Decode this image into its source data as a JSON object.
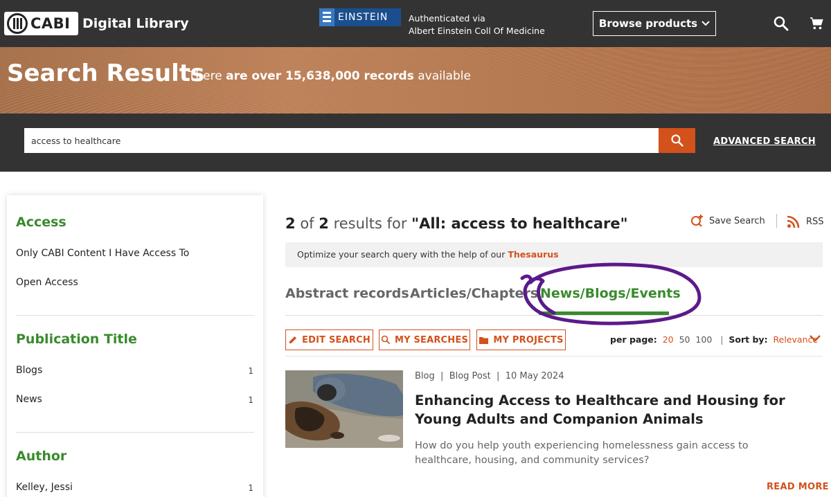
{
  "header": {
    "logo_brand": "CABI",
    "logo_text": "Digital Library",
    "institution_logo": "EINSTEIN",
    "auth_line1": "Authenticated via",
    "auth_line2": "Albert Einstein Coll Of Medicine",
    "browse_label": "Browse products",
    "icons": [
      "search-icon",
      "cart-icon"
    ]
  },
  "hero": {
    "title": "Search Results",
    "sub_prefix": "There",
    "sub_bold": "are over 15,638,000 records",
    "sub_suffix": "available"
  },
  "search": {
    "value": "access to healthcare",
    "advanced_label": "ADVANCED SEARCH"
  },
  "sidebar": {
    "access_heading": "Access",
    "access_items": [
      "Only CABI Content I Have Access To",
      "Open Access"
    ],
    "pub_heading": "Publication Title",
    "pub_items": [
      {
        "label": "Blogs",
        "count": "1"
      },
      {
        "label": "News",
        "count": "1"
      }
    ],
    "author_heading": "Author",
    "author_items": [
      {
        "label": "Kelley, Jessi",
        "count": "1"
      }
    ]
  },
  "results": {
    "shown": "2",
    "of": "of",
    "total": "2",
    "results_for": "results for",
    "query": "\"All: access to healthcare\"",
    "save_search": "Save Search",
    "rss": "RSS",
    "optimize_text": "Optimize your search query with the help of our",
    "thesaurus": "Thesaurus"
  },
  "tabs": [
    {
      "label": "Abstract records",
      "active": false
    },
    {
      "label": "Articles/Chapters",
      "active": false
    },
    {
      "label": "News/Blogs/Events",
      "active": true
    }
  ],
  "toolbar": {
    "edit_search": "EDIT SEARCH",
    "my_searches": "MY SEARCHES",
    "my_projects": "MY PROJECTS",
    "per_page_label": "per page:",
    "per_page_options": [
      "20",
      "50",
      "100"
    ],
    "per_page_selected": "20",
    "sort_label": "Sort by:",
    "sort_value": "Relevance"
  },
  "result_item": {
    "type": "Blog",
    "subtype": "Blog Post",
    "date": "10 May 2024",
    "title": "Enhancing Access to Healthcare and Housing for Young Adults and Companion Animals",
    "description": "How do you help youth experiencing homelessness gain access to healthcare, housing, and community services?",
    "read_more": "READ MORE"
  },
  "colors": {
    "accent_orange": "#d3511b",
    "accent_green": "#3a8a2e",
    "header_bg": "#333333",
    "annotation_purple": "#5b1a8a"
  }
}
